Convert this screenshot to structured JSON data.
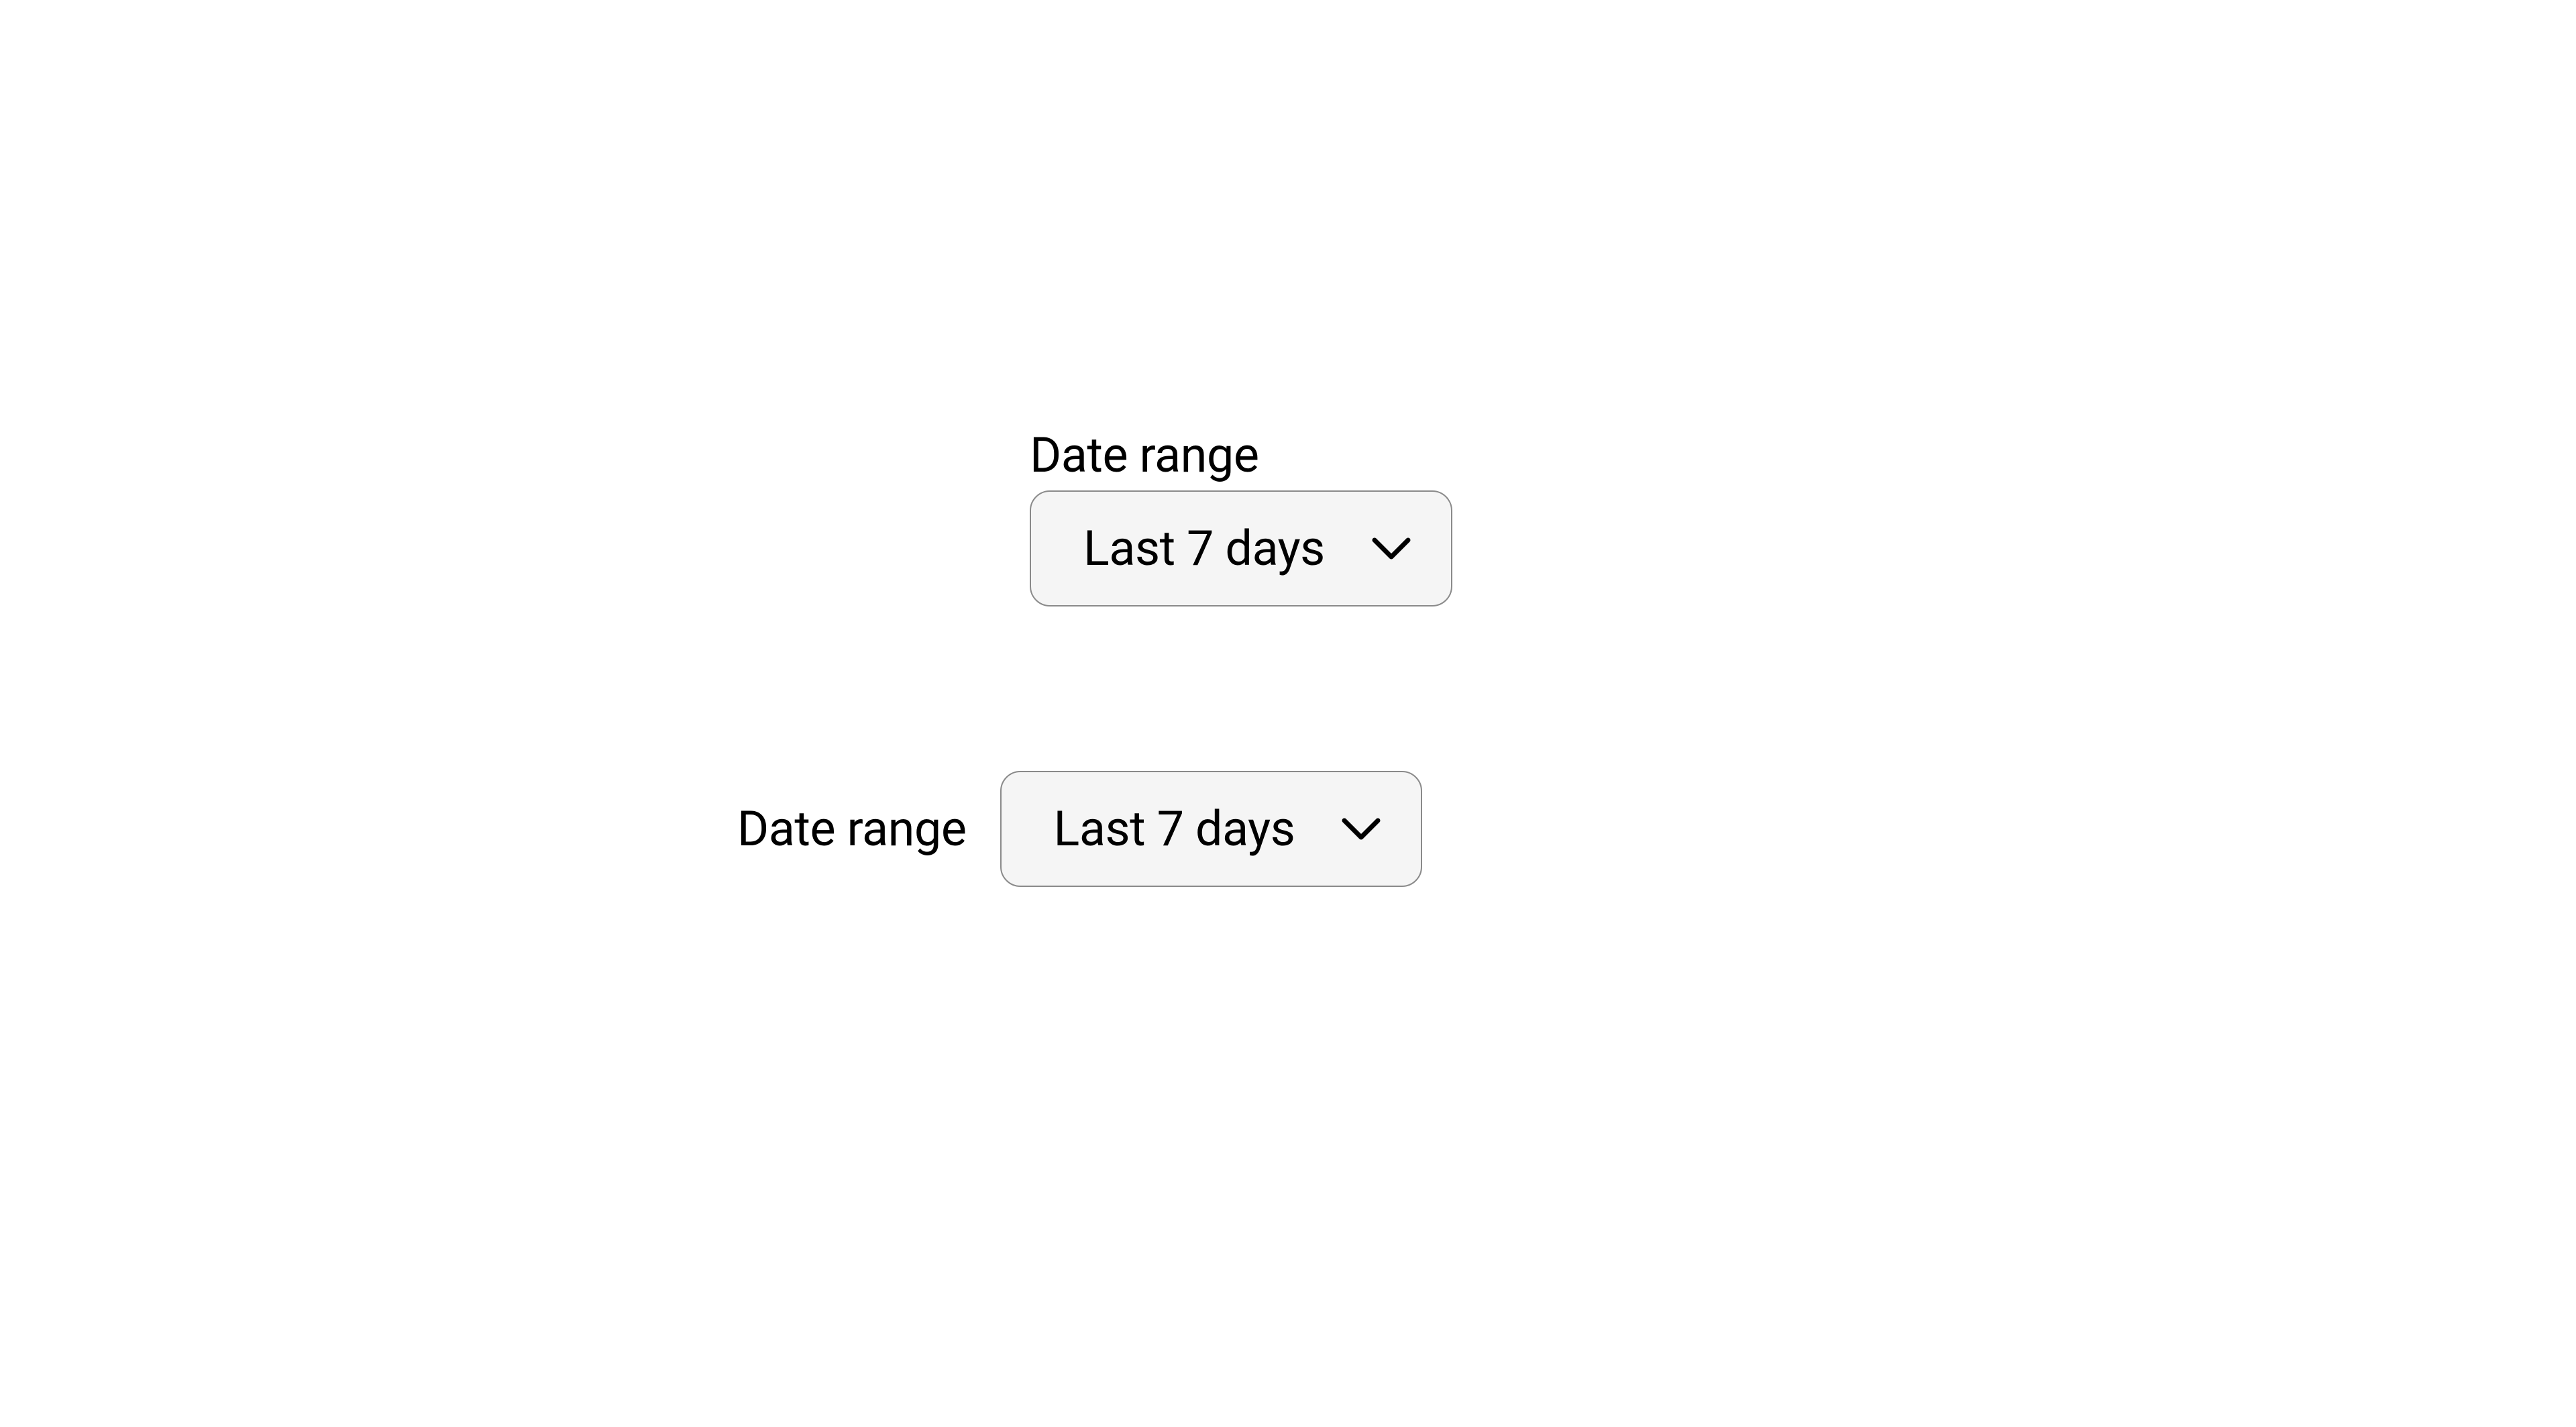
{
  "fields": {
    "stacked": {
      "label": "Date range",
      "selected": "Last 7 days"
    },
    "inline": {
      "label": "Date range",
      "selected": "Last 7 days"
    }
  },
  "colors": {
    "text": "#000000",
    "select_bg": "#f5f5f5",
    "select_border": "#8a8a8a"
  }
}
